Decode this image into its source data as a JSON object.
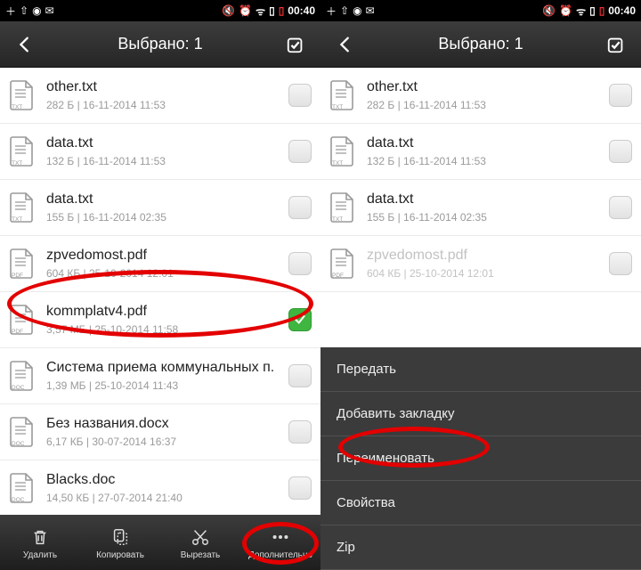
{
  "status": {
    "time": "00:40"
  },
  "appbar": {
    "title": "Выбрано: 1"
  },
  "files": [
    {
      "name": "other.txt",
      "sub": "282 Б | 16-11-2014 11:53",
      "ext": "TXT",
      "selected": false
    },
    {
      "name": "data.txt",
      "sub": "132 Б | 16-11-2014 11:53",
      "ext": "TXT",
      "selected": false
    },
    {
      "name": "data.txt",
      "sub": "155 Б | 16-11-2014 02:35",
      "ext": "TXT",
      "selected": false
    },
    {
      "name": "zpvedomost.pdf",
      "sub": "604 КБ | 25-10-2014 12:01",
      "ext": "PDF",
      "selected": false
    },
    {
      "name": "kommplatv4.pdf",
      "sub": "3,57 МБ | 25-10-2014 11:58",
      "ext": "PDF",
      "selected": true
    }
  ],
  "left_extra": [
    {
      "name": "Система приема коммунальных п.",
      "sub": "1,39 МБ | 25-10-2014 11:43",
      "ext": "DOC"
    },
    {
      "name": "Без названия.docx",
      "sub": "6,17 КБ | 30-07-2014 16:37",
      "ext": "DOC"
    },
    {
      "name": "Blacks.doc",
      "sub": "14,50 КБ | 27-07-2014 21:40",
      "ext": "DOC"
    }
  ],
  "toolbar": {
    "delete": "Удалить",
    "copy": "Копировать",
    "cut": "Вырезать",
    "more": "Дополнительно"
  },
  "menu": {
    "items": [
      "Передать",
      "Добавить закладку",
      "Переименовать",
      "Свойства",
      "Zip"
    ]
  }
}
